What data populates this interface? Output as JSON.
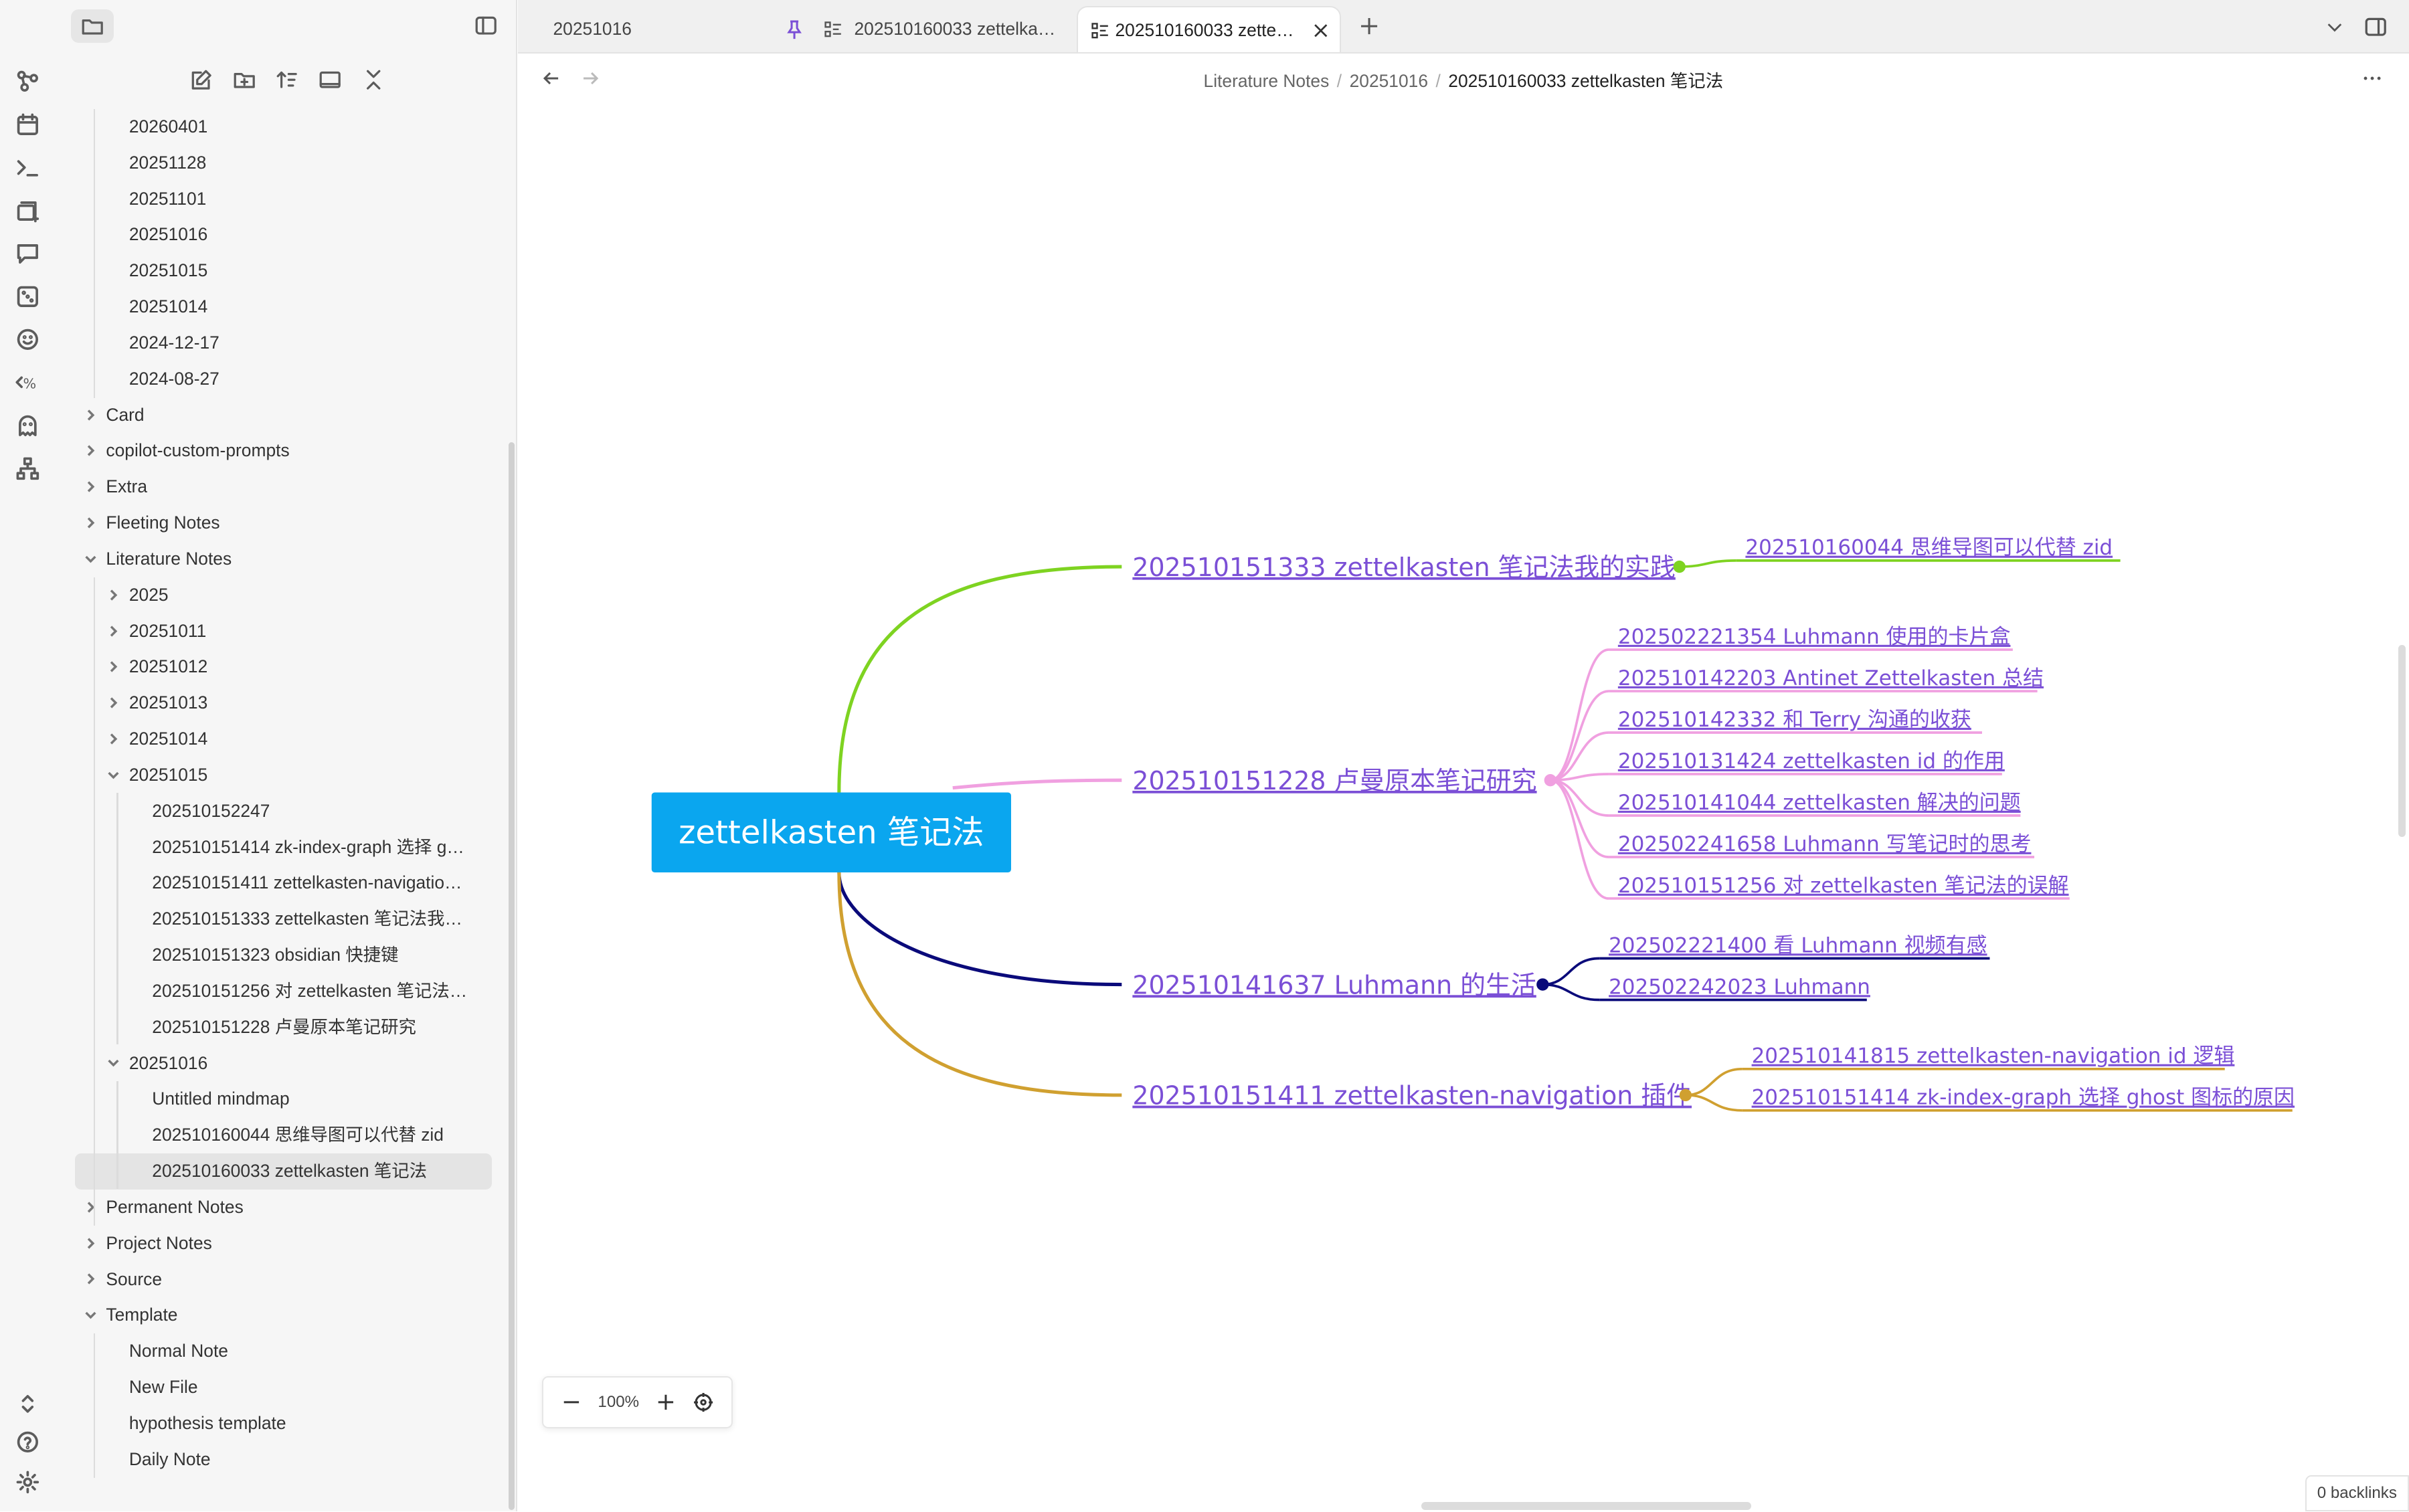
{
  "ribbon": {
    "icons": [
      "graph-icon",
      "calendar-icon",
      "terminal-icon",
      "cards-add-icon",
      "comment-icon",
      "dice-icon",
      "smiley-icon",
      "templater-icon",
      "ghost-icon",
      "sitemap-icon"
    ],
    "bottom_icons": [
      "vault-switch-icon",
      "help-icon",
      "settings-icon"
    ]
  },
  "sidebar": {
    "toolbar_icons": [
      "new-note-icon",
      "new-folder-icon",
      "sort-icon",
      "collapse-view-icon",
      "collapse-all-icon"
    ],
    "tree": [
      {
        "label": "20260401",
        "level": 1,
        "type": "file"
      },
      {
        "label": "20251128",
        "level": 1,
        "type": "file"
      },
      {
        "label": "20251101",
        "level": 1,
        "type": "file"
      },
      {
        "label": "20251016",
        "level": 1,
        "type": "file"
      },
      {
        "label": "20251015",
        "level": 1,
        "type": "file"
      },
      {
        "label": "20251014",
        "level": 1,
        "type": "file"
      },
      {
        "label": "2024-12-17",
        "level": 1,
        "type": "file"
      },
      {
        "label": "2024-08-27",
        "level": 1,
        "type": "file"
      },
      {
        "label": "Card",
        "level": 0,
        "type": "folder",
        "open": false
      },
      {
        "label": "copilot-custom-prompts",
        "level": 0,
        "type": "folder",
        "open": false
      },
      {
        "label": "Extra",
        "level": 0,
        "type": "folder",
        "open": false
      },
      {
        "label": "Fleeting Notes",
        "level": 0,
        "type": "folder",
        "open": false
      },
      {
        "label": "Literature Notes",
        "level": 0,
        "type": "folder",
        "open": true
      },
      {
        "label": "2025",
        "level": 1,
        "type": "folder",
        "open": false
      },
      {
        "label": "20251011",
        "level": 1,
        "type": "folder",
        "open": false
      },
      {
        "label": "20251012",
        "level": 1,
        "type": "folder",
        "open": false
      },
      {
        "label": "20251013",
        "level": 1,
        "type": "folder",
        "open": false
      },
      {
        "label": "20251014",
        "level": 1,
        "type": "folder",
        "open": false
      },
      {
        "label": "20251015",
        "level": 1,
        "type": "folder",
        "open": true
      },
      {
        "label": "202510152247",
        "level": 2,
        "type": "file"
      },
      {
        "label": "202510151414 zk-index-graph 选择 g…",
        "level": 2,
        "type": "file"
      },
      {
        "label": "202510151411 zettelkasten-navigatio…",
        "level": 2,
        "type": "file"
      },
      {
        "label": "202510151333 zettelkasten 笔记法我…",
        "level": 2,
        "type": "file"
      },
      {
        "label": "202510151323 obsidian 快捷键",
        "level": 2,
        "type": "file"
      },
      {
        "label": "202510151256 对 zettelkasten 笔记法…",
        "level": 2,
        "type": "file"
      },
      {
        "label": "202510151228 卢曼原本笔记研究",
        "level": 2,
        "type": "file"
      },
      {
        "label": "20251016",
        "level": 1,
        "type": "folder",
        "open": true
      },
      {
        "label": "Untitled mindmap",
        "level": 2,
        "type": "file"
      },
      {
        "label": "202510160044 思维导图可以代替 zid",
        "level": 2,
        "type": "file"
      },
      {
        "label": "202510160033 zettelkasten 笔记法",
        "level": 2,
        "type": "file",
        "active": true
      },
      {
        "label": "Permanent Notes",
        "level": 0,
        "type": "folder",
        "open": false
      },
      {
        "label": "Project Notes",
        "level": 0,
        "type": "folder",
        "open": false
      },
      {
        "label": "Source",
        "level": 0,
        "type": "folder",
        "open": false
      },
      {
        "label": "Template",
        "level": 0,
        "type": "folder",
        "open": true
      },
      {
        "label": "Normal Note",
        "level": 1,
        "type": "file"
      },
      {
        "label": "New File",
        "level": 1,
        "type": "file"
      },
      {
        "label": "hypothesis template",
        "level": 1,
        "type": "file"
      },
      {
        "label": "Daily Note",
        "level": 1,
        "type": "file"
      }
    ]
  },
  "tabs": [
    {
      "label": "20251016",
      "pinned": true
    },
    {
      "label": "202510160033 zettelka…",
      "icon": "mindmap-icon"
    },
    {
      "label": "202510160033 zette…",
      "icon": "mindmap-icon",
      "active": true
    }
  ],
  "breadcrumb": {
    "parts": [
      "Literature Notes",
      "20251016"
    ],
    "current": "202510160033 zettelkasten 笔记法"
  },
  "mindmap": {
    "root": "zettelkasten 笔记法",
    "root_color": "#0aa6ef",
    "branches": [
      {
        "label": "202510151333 zettelkasten 笔记法我的实践",
        "color": "#7ed321",
        "children": [
          "202510160044 思维导图可以代替 zid"
        ]
      },
      {
        "label": "202510151228 卢曼原本笔记研究",
        "color": "#f0a0e0",
        "children": [
          "202502221354 Luhmann 使用的卡片盒",
          "202510142203 Antinet Zettelkasten 总结",
          "202510142332 和 Terry 沟通的收获",
          "202510131424 zettelkasten id 的作用",
          "202510141044 zettelkasten 解决的问题",
          "202502241658 Luhmann 写笔记时的思考",
          "202510151256 对 zettelkasten 笔记法的误解"
        ]
      },
      {
        "label": "202510141637 Luhmann 的生活",
        "color": "#0a0a7a",
        "children": [
          "202502221400 看 Luhmann 视频有感",
          "202502242023 Luhmann"
        ]
      },
      {
        "label": "202510151411 zettelkasten-navigation 插件",
        "color": "#d0a030",
        "children": [
          "202510141815 zettelkasten-navigation id 逻辑",
          "202510151414 zk-index-graph 选择 ghost 图标的原因"
        ]
      }
    ]
  },
  "zoom": {
    "level": "100%"
  },
  "status": {
    "backlinks": "0 backlinks"
  }
}
